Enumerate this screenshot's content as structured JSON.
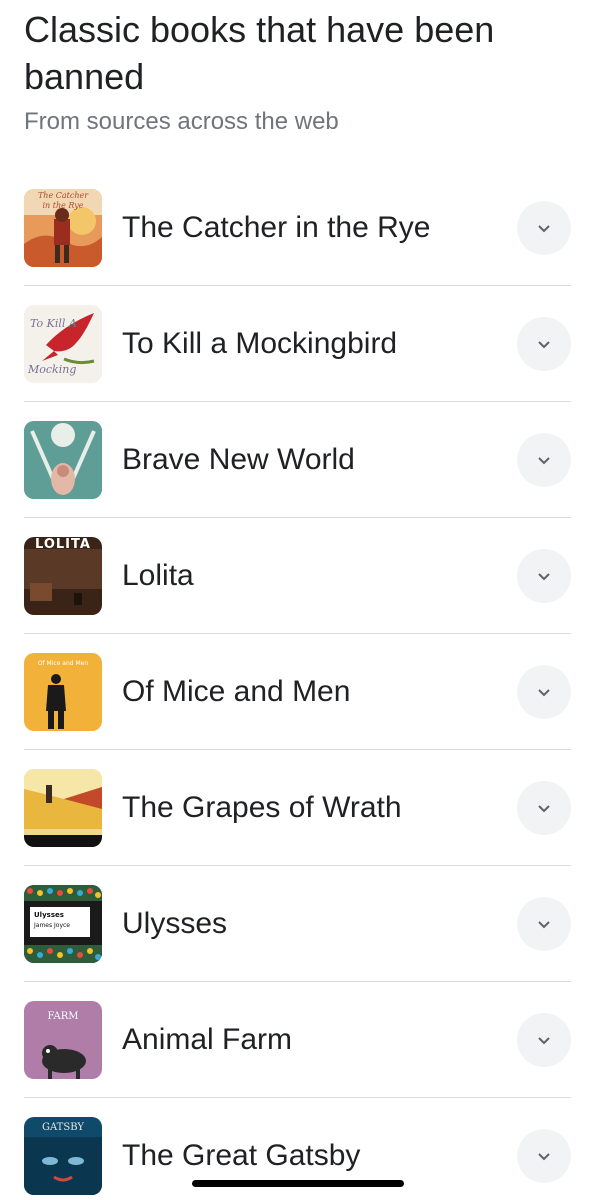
{
  "header": {
    "title": "Classic books that have been banned",
    "subtitle": "From sources across the web"
  },
  "books": [
    {
      "title": "The Catcher in the Rye",
      "icon": "catcher-cover",
      "cover_text": "The Catcher in the Rye"
    },
    {
      "title": "To Kill a Mockingbird",
      "icon": "mockingbird-cover",
      "cover_text": "To Kill A Mockingbird"
    },
    {
      "title": "Brave New World",
      "icon": "brave-new-world-cover",
      "cover_text": ""
    },
    {
      "title": "Lolita",
      "icon": "lolita-cover",
      "cover_text": "LOLITA"
    },
    {
      "title": "Of Mice and Men",
      "icon": "mice-and-men-cover",
      "cover_text": "Of Mice and Men"
    },
    {
      "title": "The Grapes of Wrath",
      "icon": "grapes-of-wrath-cover",
      "cover_text": ""
    },
    {
      "title": "Ulysses",
      "icon": "ulysses-cover",
      "cover_text": "Ulysses",
      "cover_author": "James Joyce"
    },
    {
      "title": "Animal Farm",
      "icon": "animal-farm-cover",
      "cover_text": "FARM"
    },
    {
      "title": "The Great Gatsby",
      "icon": "great-gatsby-cover",
      "cover_text": "GATSBY"
    }
  ],
  "expand_icon": "chevron-down-icon",
  "colors": {
    "text": "#202124",
    "subtitle": "#70757a",
    "divider": "#dadce0",
    "expand_bg": "#f1f3f4"
  }
}
